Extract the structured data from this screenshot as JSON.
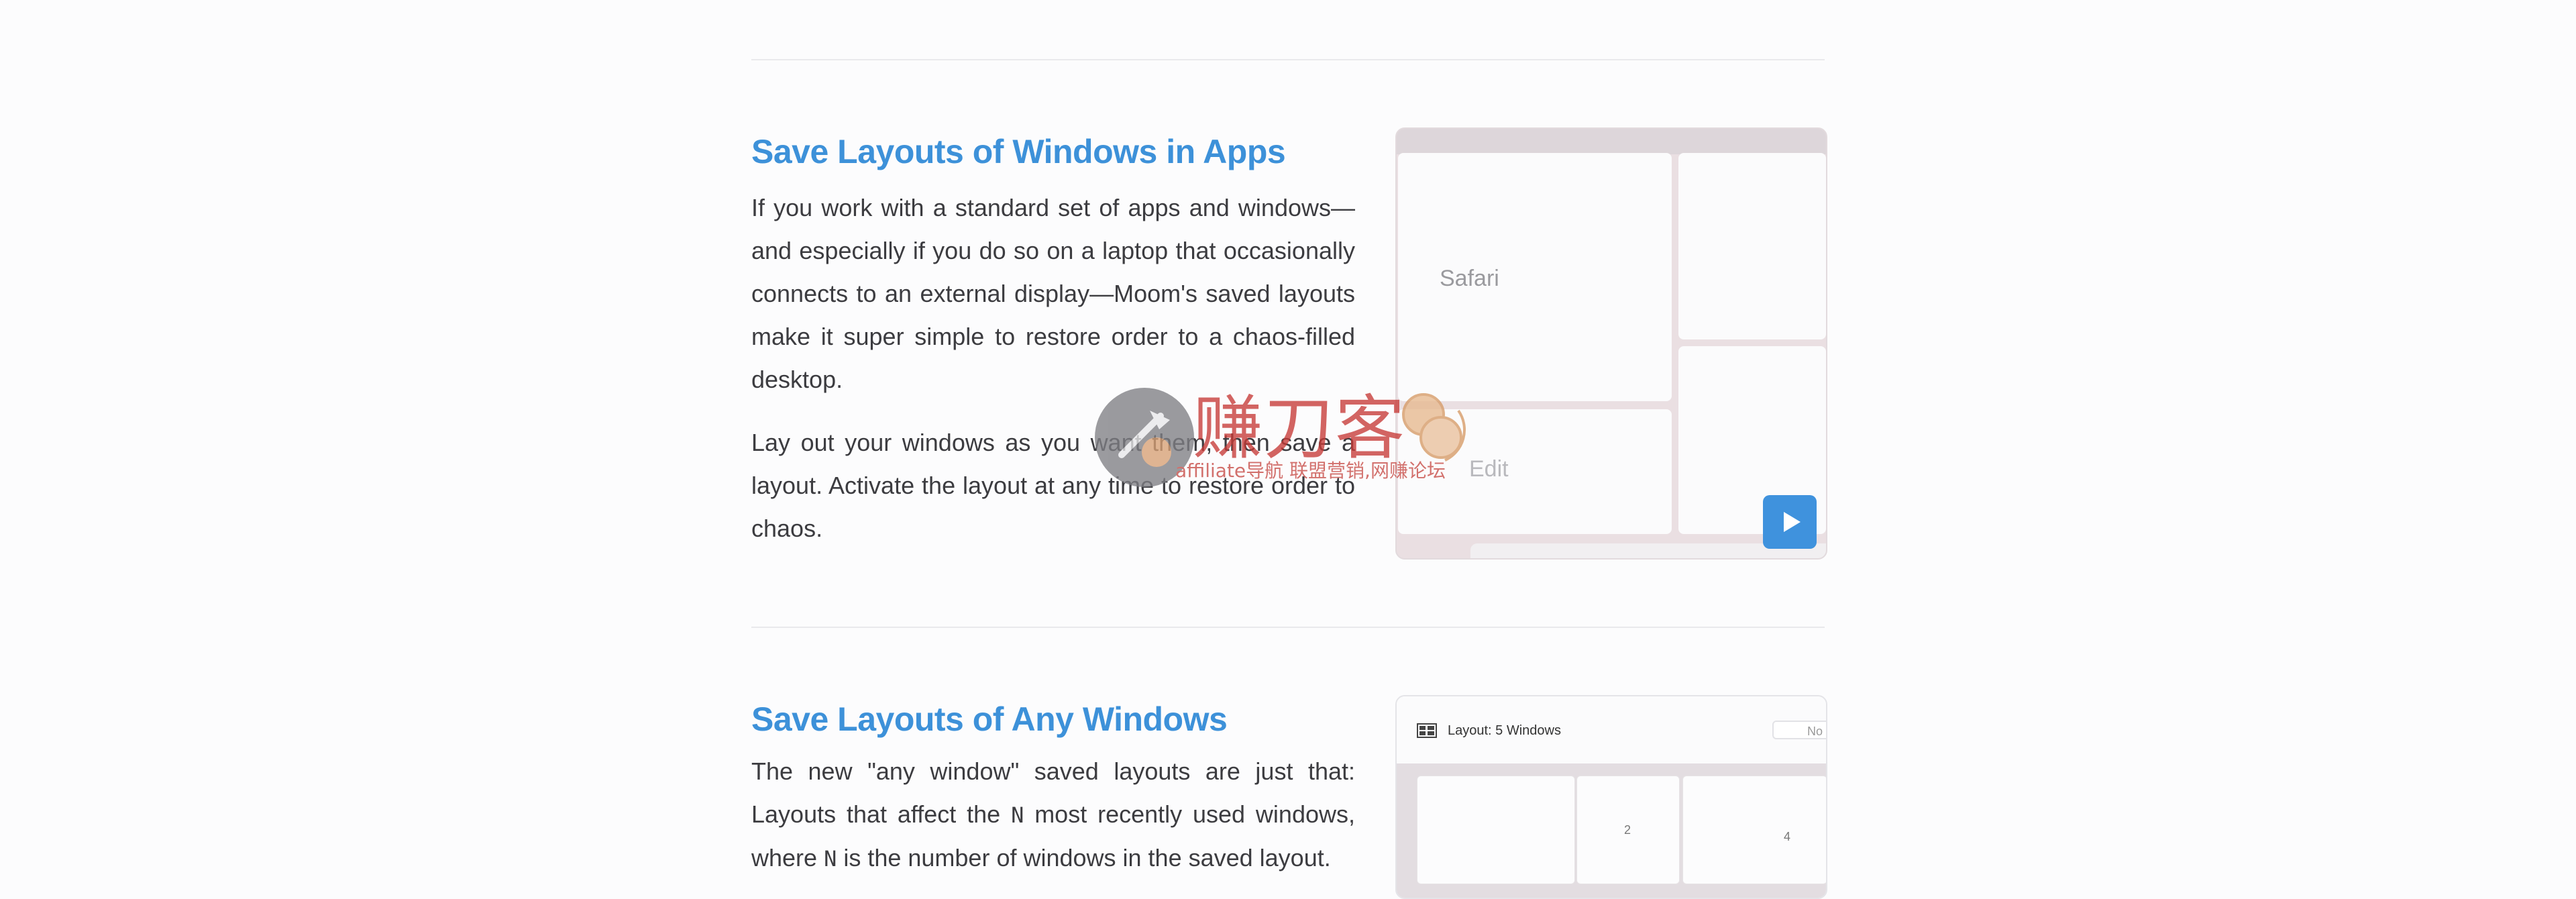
{
  "sections": [
    {
      "title": "Save Layouts of Windows in Apps",
      "paragraphs": [
        "If you work with a standard set of apps and windows—and especially if you do so on a laptop that occasionally connects to an external display—Moom's saved layouts make it super simple to restore order to a chaos-filled desktop.",
        "Lay out your windows as you want them, then save a layout. Activate the layout at any time to restore order to chaos."
      ],
      "screenshot": {
        "pane_label": "Safari",
        "play_icon": "play-icon"
      }
    },
    {
      "title": "Save Layouts of Any Windows",
      "paragraph": {
        "part1": "The new \"any window\" saved layouts are just that: Layouts that affect the ",
        "n1": "N",
        "part2": " most recently used windows, where ",
        "n2": "N",
        "part3": " is the number of windows in the saved layout."
      },
      "screenshot": {
        "window_title": "Layout: 5 Windows",
        "field_text": "No",
        "pane_numbers": [
          "2",
          "4"
        ],
        "icon": "grid-layout-icon"
      }
    }
  ],
  "watermark": {
    "title": "赚刀客",
    "subtitle": "affiliate导航 联盟营销,网赚论坛",
    "edit_text": "Edit"
  },
  "colors": {
    "heading": "#3d91d9",
    "play_button": "#3f92dd",
    "watermark": "#c73a37"
  }
}
